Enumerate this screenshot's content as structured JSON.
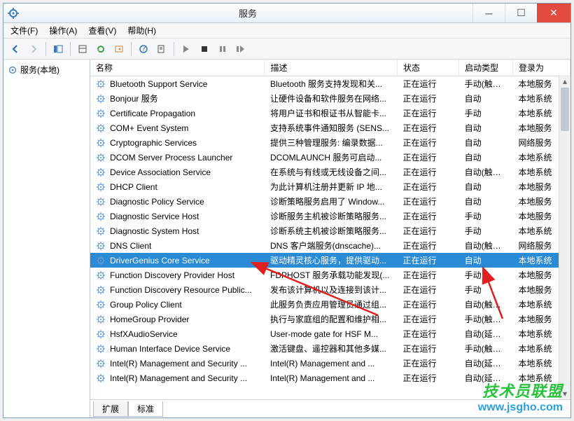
{
  "title": "服务",
  "menus": {
    "file": "文件(F)",
    "action": "操作(A)",
    "view": "查看(V)",
    "help": "帮助(H)"
  },
  "tree": {
    "root": "服务(本地)"
  },
  "columns": {
    "name": "名称",
    "desc": "描述",
    "status": "状态",
    "startup": "启动类型",
    "logon": "登录为"
  },
  "tabs": {
    "extended": "扩展",
    "standard": "标准"
  },
  "selected_index": 13,
  "services": [
    {
      "name": "Bluetooth Support Service",
      "desc": "Bluetooth 服务支持发现和关...",
      "status": "正在运行",
      "startup": "手动(触发...",
      "logon": "本地服务"
    },
    {
      "name": "Bonjour 服务",
      "desc": "让硬件设备和软件服务在网络...",
      "status": "正在运行",
      "startup": "自动",
      "logon": "本地系统"
    },
    {
      "name": "Certificate Propagation",
      "desc": "将用户证书和根证书从智能卡...",
      "status": "正在运行",
      "startup": "手动",
      "logon": "本地系统"
    },
    {
      "name": "COM+ Event System",
      "desc": "支持系统事件通知服务 (SENS...",
      "status": "正在运行",
      "startup": "自动",
      "logon": "本地服务"
    },
    {
      "name": "Cryptographic Services",
      "desc": "提供三种管理服务: 编录数据...",
      "status": "正在运行",
      "startup": "自动",
      "logon": "网络服务"
    },
    {
      "name": "DCOM Server Process Launcher",
      "desc": "DCOMLAUNCH 服务可启动...",
      "status": "正在运行",
      "startup": "自动",
      "logon": "本地系统"
    },
    {
      "name": "Device Association Service",
      "desc": "在系统与有线或无线设备之间...",
      "status": "正在运行",
      "startup": "自动(触发...",
      "logon": "本地系统"
    },
    {
      "name": "DHCP Client",
      "desc": "为此计算机注册并更新 IP 地...",
      "status": "正在运行",
      "startup": "自动",
      "logon": "本地服务"
    },
    {
      "name": "Diagnostic Policy Service",
      "desc": "诊断策略服务启用了 Window...",
      "status": "正在运行",
      "startup": "自动",
      "logon": "本地服务"
    },
    {
      "name": "Diagnostic Service Host",
      "desc": "诊断服务主机被诊断策略服务...",
      "status": "正在运行",
      "startup": "手动",
      "logon": "本地服务"
    },
    {
      "name": "Diagnostic System Host",
      "desc": "诊断系统主机被诊断策略服务...",
      "status": "正在运行",
      "startup": "手动",
      "logon": "本地系统"
    },
    {
      "name": "DNS Client",
      "desc": "DNS 客户端服务(dnscache)...",
      "status": "正在运行",
      "startup": "自动(触发...",
      "logon": "网络服务"
    },
    {
      "name": "",
      "desc": "",
      "status": "",
      "startup": "",
      "logon": ""
    },
    {
      "name": "DriverGenius Core Service",
      "desc": "驱动精灵核心服务，提供驱动...",
      "status": "正在运行",
      "startup": "自动",
      "logon": "本地系统"
    },
    {
      "name": "Function Discovery Provider Host",
      "desc": "FDPHOST 服务承载功能发现(...",
      "status": "正在运行",
      "startup": "手动",
      "logon": "本地服务"
    },
    {
      "name": "Function Discovery Resource Public...",
      "desc": "发布该计算机以及连接到该计...",
      "status": "正在运行",
      "startup": "手动",
      "logon": "本地服务"
    },
    {
      "name": "Group Policy Client",
      "desc": "此服务负责应用管理员通过组...",
      "status": "正在运行",
      "startup": "自动(触发...",
      "logon": "本地系统"
    },
    {
      "name": "HomeGroup Provider",
      "desc": "执行与家庭组的配置和维护相...",
      "status": "正在运行",
      "startup": "手动(触发...",
      "logon": "本地服务"
    },
    {
      "name": "HsfXAudioService",
      "desc": "User-mode gate for HSF M...",
      "status": "正在运行",
      "startup": "自动(延迟...",
      "logon": "本地系统"
    },
    {
      "name": "Human Interface Device Service",
      "desc": "激活键盘、遥控器和其他多媒...",
      "status": "正在运行",
      "startup": "手动(触发...",
      "logon": "本地系统"
    },
    {
      "name": "Intel(R) Management and Security ...",
      "desc": "Intel(R) Management and ...",
      "status": "正在运行",
      "startup": "自动(延迟...",
      "logon": "本地系统"
    },
    {
      "name": "Intel(R) Management and Security ...",
      "desc": "Intel(R) Management and ...",
      "status": "正在运行",
      "startup": "自动(延迟...",
      "logon": "本地系统"
    }
  ],
  "watermark": {
    "line1": "技术员联盟",
    "line2": "www.jsgho.com"
  }
}
